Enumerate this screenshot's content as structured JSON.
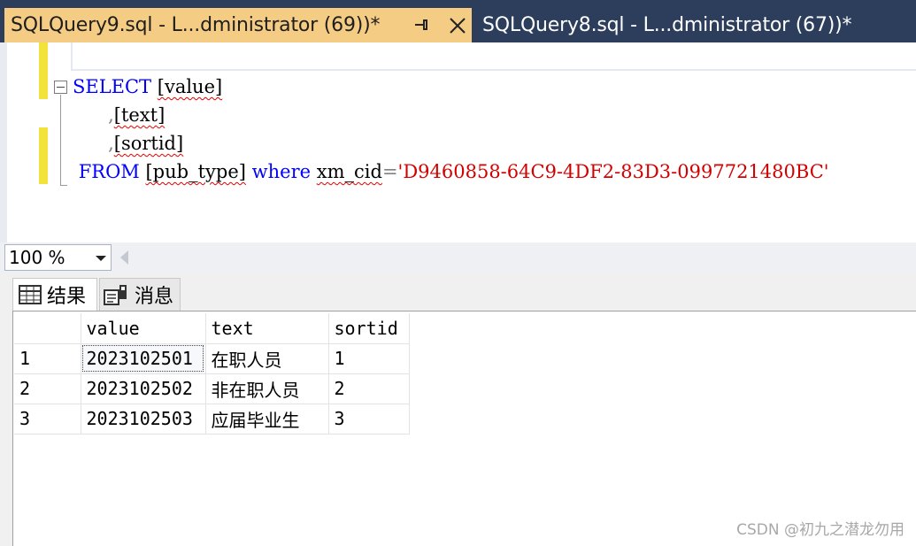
{
  "tabs": [
    {
      "title": "SQLQuery9.sql - L...dministrator (69))*",
      "active": true
    },
    {
      "title": "SQLQuery8.sql - L...dministrator (67))*",
      "active": false
    }
  ],
  "editor": {
    "line1": {
      "keyword": "SELECT",
      "column": "[value]"
    },
    "line2": {
      "comma": ",",
      "column": "[text]"
    },
    "line3": {
      "comma": ",",
      "column": "[sortid]"
    },
    "line4": {
      "from": "FROM",
      "table": "[pub_type]",
      "where": "where",
      "field": "xm_cid",
      "op": "=",
      "literal": "'D9460858-64C9-4DF2-83D3-0997721480BC'"
    }
  },
  "zoom": {
    "value": "100 %"
  },
  "results_tabs": {
    "results": "结果",
    "messages": "消息"
  },
  "grid": {
    "columns": [
      "value",
      "text",
      "sortid"
    ],
    "rows": [
      {
        "num": "1",
        "value": "2023102501",
        "text": "在职人员",
        "sortid": "1"
      },
      {
        "num": "2",
        "value": "2023102502",
        "text": "非在职人员",
        "sortid": "2"
      },
      {
        "num": "3",
        "value": "2023102503",
        "text": "应届毕业生",
        "sortid": "3"
      }
    ]
  },
  "watermark": "CSDN @初九之潜龙勿用",
  "colors": {
    "tabbar_bg": "#2d3e5c",
    "active_tab": "#f5cc84",
    "keyword": "#0000ff",
    "string": "#d40000",
    "change_bar": "#f2e23c"
  }
}
